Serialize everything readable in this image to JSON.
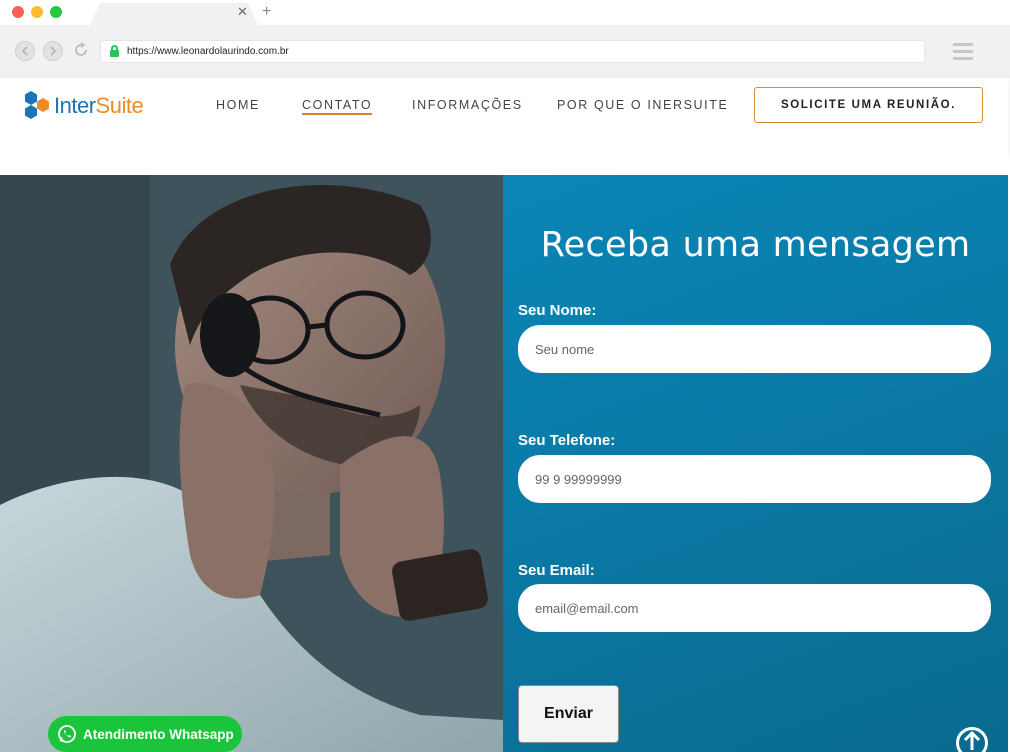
{
  "browser": {
    "url": "https://www.leonardolaurindo.com.br",
    "tab_close": "✕",
    "tab_new": "+"
  },
  "header": {
    "logo_part1": "Inter",
    "logo_part2": "Suite",
    "nav": [
      {
        "label": "HOME"
      },
      {
        "label": "CONTATO"
      },
      {
        "label": "INFORMAÇÕES"
      },
      {
        "label": "POR QUE O INERSUITE"
      }
    ],
    "cta_label": "SOLICITE UMA REUNIÃO."
  },
  "form": {
    "title": "Receba uma mensagem",
    "fields": [
      {
        "label": "Seu Nome:",
        "placeholder": "Seu nome"
      },
      {
        "label": "Seu Telefone:",
        "placeholder": "99 9 99999999"
      },
      {
        "label": "Seu Email:",
        "placeholder": "email@email.com"
      }
    ],
    "submit_label": "Enviar"
  },
  "whatsapp_label": "Atendimento Whatsapp",
  "colors": {
    "brand_blue": "#1b74b8",
    "brand_orange": "#f08a24",
    "form_panel": "#0a7aa6",
    "whatsapp_green": "#1bc53b"
  }
}
